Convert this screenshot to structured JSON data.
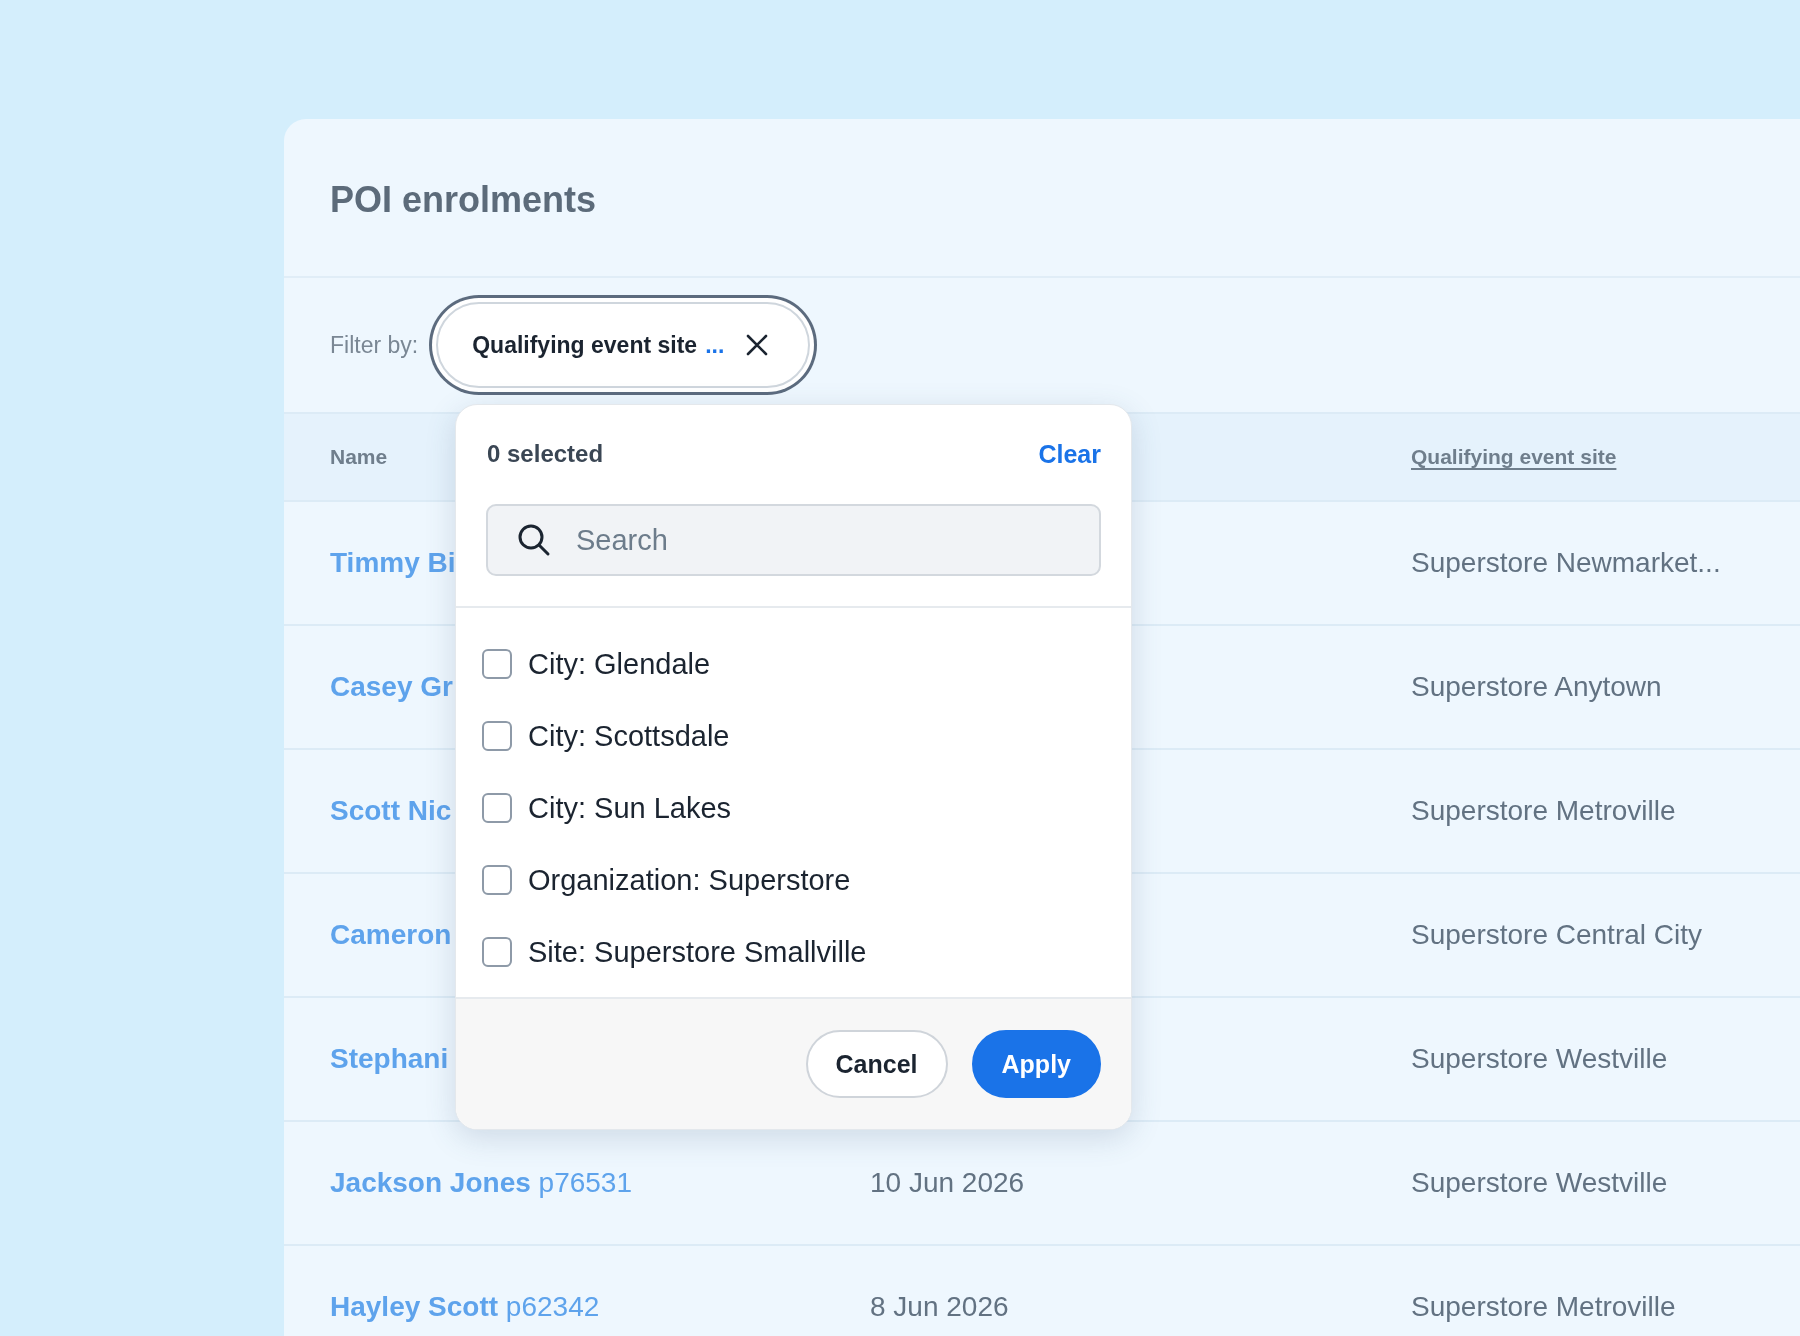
{
  "page": {
    "title": "POI enrolments"
  },
  "filter_bar": {
    "label": "Filter by:",
    "chip": {
      "label": "Qualifying event site",
      "more": "...",
      "focused": true
    }
  },
  "table": {
    "header": {
      "name": "Name",
      "site": "Qualifying event site"
    },
    "rows": [
      {
        "name": "Timmy Bi",
        "site": "Superstore Newmarket..."
      },
      {
        "name": "Casey Gr",
        "site": "Superstore Anytown"
      },
      {
        "name": "Scott Nic",
        "site": "Superstore Metroville"
      },
      {
        "name": "Cameron",
        "site": "Superstore Central City"
      },
      {
        "name": "Stephani",
        "site": "Superstore Westville"
      },
      {
        "name": "Jackson Jones",
        "id": "p76531",
        "date": "10 Jun 2026",
        "site": "Superstore Westville"
      },
      {
        "name": "Hayley Scott",
        "id": "p62342",
        "date": "8 Jun 2026",
        "site": "Superstore Metroville"
      }
    ]
  },
  "filter_popover": {
    "count_label": "0 selected",
    "clear": "Clear",
    "search_placeholder": "Search",
    "options": [
      {
        "label": "City: Glendale",
        "checked": false
      },
      {
        "label": "City: Scottsdale",
        "checked": false
      },
      {
        "label": "City: Sun Lakes",
        "checked": false
      },
      {
        "label": "Organization: Superstore",
        "checked": false
      },
      {
        "label": "Site: Superstore Smallville",
        "checked": false
      }
    ],
    "buttons": [
      {
        "label": "Cancel",
        "kind": "secondary"
      },
      {
        "label": "Apply",
        "kind": "primary"
      }
    ]
  }
}
